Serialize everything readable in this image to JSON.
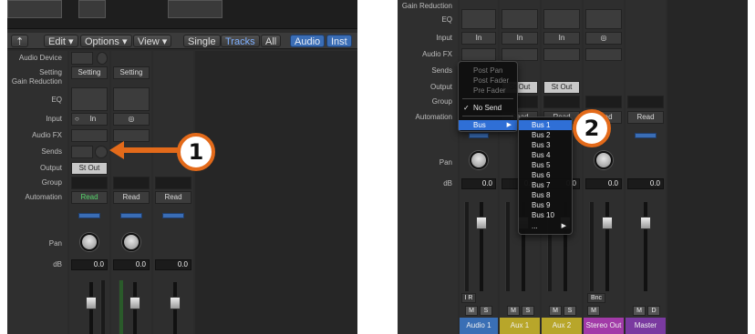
{
  "left": {
    "toolbar": {
      "edit": "Edit",
      "options": "Options",
      "view": "View",
      "single": "Single",
      "tracks": "Tracks",
      "all": "All",
      "audio": "Audio",
      "inst": "Inst"
    },
    "labels": {
      "audio_device": "Audio Device",
      "setting": "Setting",
      "gain_reduction": "Gain Reduction",
      "eq": "EQ",
      "input": "Input",
      "audio_fx": "Audio FX",
      "sends": "Sends",
      "output": "Output",
      "group": "Group",
      "automation": "Automation",
      "pan": "Pan",
      "db": "dB"
    },
    "strip1": {
      "setting": "Setting",
      "input": "In",
      "output": "St Out",
      "automation": "Read",
      "db": "0.0"
    },
    "strip2": {
      "setting": "Setting",
      "input": "◎",
      "automation": "Read",
      "db": "0.0"
    },
    "strip3": {
      "automation": "Read",
      "db": "0.0"
    },
    "callout": "1"
  },
  "right": {
    "labels": {
      "gain_reduction": "Gain Reduction",
      "eq": "EQ",
      "input": "Input",
      "audio_fx": "Audio FX",
      "sends": "Sends",
      "output": "Output",
      "group": "Group",
      "automation": "Automation",
      "pan": "Pan",
      "db": "dB"
    },
    "strips": [
      {
        "name": "Audio 1",
        "color": "#3a6fb5",
        "input": "In",
        "db": "0.0",
        "bottom_btns": [
          "M",
          "S"
        ],
        "io": "I R"
      },
      {
        "name": "Aux 1",
        "color": "#b8a62a",
        "input": "In",
        "output": "St Out",
        "automation": "Read",
        "db": "0.0",
        "bottom_btns": [
          "M",
          "S"
        ]
      },
      {
        "name": "Aux 2",
        "color": "#b8a62a",
        "input": "In",
        "output": "St Out",
        "automation": "Read",
        "db": "0.0",
        "bottom_btns": [
          "M",
          "S"
        ]
      },
      {
        "name": "Stereo Out",
        "color": "#a23aa8",
        "input": "◎",
        "automation": "Read",
        "db": "0.0",
        "bottom_btns": [
          "M"
        ],
        "io": "Bnc"
      },
      {
        "name": "Master",
        "color": "#7a3aa0",
        "automation": "Read",
        "db": "0.0",
        "bottom_btns": [
          "M",
          "D"
        ]
      }
    ],
    "send_menu": {
      "post_pan": "Post Pan",
      "post_fader": "Post Fader",
      "pre_fader": "Pre Fader",
      "no_send": "No Send",
      "check": "✓",
      "bus": "Bus",
      "arrow": "▶"
    },
    "bus_menu": {
      "items": [
        "Bus 1",
        "Bus 2",
        "Bus 3",
        "Bus 4",
        "Bus 5",
        "Bus 6",
        "Bus 7",
        "Bus 8",
        "Bus 9",
        "Bus 10"
      ],
      "more": "...",
      "arrow": "▶"
    },
    "callout": "2"
  },
  "colors": {
    "accent": "#e36a1a",
    "highlight": "#2f6fd6",
    "read_green": "#55d36a"
  }
}
